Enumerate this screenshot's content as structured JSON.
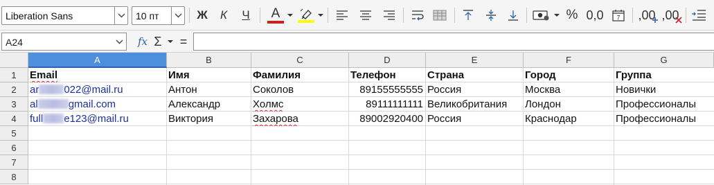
{
  "toolbar": {
    "font_name": "Liberation Sans",
    "font_size": "10 пт",
    "bold_label": "Ж",
    "italic_label": "К",
    "underline_label": "Ч",
    "font_color_label": "A",
    "percent_label": "%",
    "number_format_label": "0,0",
    "add_decimal_label": ",00",
    "remove_decimal_label": ",00",
    "font_color": "#c9211e",
    "highlight_color": "#ffff00"
  },
  "formula_bar": {
    "cell_reference": "A24",
    "function_wizard_label": "fx",
    "sum_label": "Σ",
    "formula_label": "=",
    "content": ""
  },
  "columns": [
    "A",
    "B",
    "C",
    "D",
    "E",
    "F",
    "G"
  ],
  "rows": [
    "1",
    "2",
    "3",
    "4",
    "5",
    "6",
    "7",
    "8"
  ],
  "headers": {
    "email": "Email",
    "name": "Имя",
    "surname": "Фамилия",
    "phone": "Телефон",
    "country": "Страна",
    "city": "Город",
    "group": "Группа"
  },
  "data": [
    {
      "email_prefix": "ar",
      "email_suffix": "022@mail.ru",
      "name": "Антон",
      "surname": "Соколов",
      "phone": "89155555555",
      "country": "Россия",
      "city": "Москва",
      "group": "Новички"
    },
    {
      "email_prefix": "al",
      "email_suffix": "gmail.com",
      "name": "Александр",
      "surname": "Холмс",
      "phone": "89111111111",
      "country": "Великобритания",
      "city": "Лондон",
      "group": "Профессионалы"
    },
    {
      "email_prefix": "full",
      "email_suffix": "e123@mail.ru",
      "name": "Виктория",
      "surname": "Захарова",
      "phone": "89002920400",
      "country": "Россия",
      "city": "Краснодар",
      "group": "Профессионалы"
    }
  ]
}
